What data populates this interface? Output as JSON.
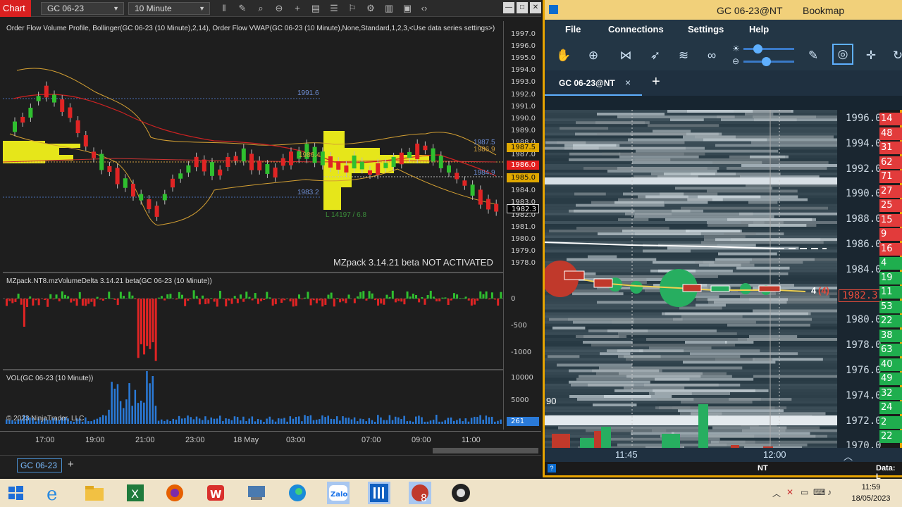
{
  "nt": {
    "chart_label": "Chart",
    "instrument": "GC 06-23",
    "interval": "10 Minute",
    "indicator_title": "Order Flow Volume Profile, Bollinger(GC 06-23 (10 Minute),2,14), Order Flow VWAP(GC 06-23 (10 Minute),None,Standard,1,2,3,<Use data series settings>)",
    "watermark": "MZpack 3.14.21 beta NOT ACTIVATED",
    "delta_title": "MZpack.NT8.mzVolumeDelta 3.14.21 beta(GC 06-23 (10 Minute))",
    "vol_title": "VOL(GC 06-23 (10 Minute))",
    "copyright": "© 2023 NinjaTrader, LLC",
    "price_labels": [
      "1997.0",
      "1996.0",
      "1995.0",
      "1994.0",
      "1993.0",
      "1992.0",
      "1991.0",
      "1990.0",
      "1989.0",
      "1988.0",
      "1987.0",
      "1986.0",
      "1985.0",
      "1984.0",
      "1983.0",
      "1982.0",
      "1981.0",
      "1980.0",
      "1979.0",
      "1978.0"
    ],
    "line_labels": {
      "l1991": "1991.6",
      "l1983": "1983.2",
      "l1987": "1987.5",
      "l1986_9": "1986.9",
      "l1986_4": "1986.4",
      "l1984_9": "1984.9",
      "poc": "L 14197 / 6.8"
    },
    "price_tags": {
      "t1987_5": "1987.5",
      "t1986": "1986.0",
      "t1985": "1985.0",
      "t1982_3": "1982.3"
    },
    "delta_axis": [
      "0",
      "-500",
      "-1000"
    ],
    "vol_axis": [
      "10000",
      "5000"
    ],
    "vol_tag": "261",
    "time_labels": [
      "17:00",
      "19:00",
      "21:00",
      "23:00",
      "18 May",
      "03:00",
      "07:00",
      "09:00",
      "11:00"
    ],
    "bottom_tab": "GC 06-23",
    "bottom_plus": "+"
  },
  "bm": {
    "title": "GC 06-23@NT",
    "app_name": "Bookmap",
    "menu": [
      "File",
      "Connections",
      "Settings",
      "Help"
    ],
    "tab": "GC 06-23@NT",
    "tab_close": "×",
    "tab_plus": "+",
    "prices": [
      "1996.0",
      "1994.0",
      "1992.0",
      "1990.0",
      "1988.0",
      "1986.0",
      "1984.0",
      "1982.3",
      "1980.0",
      "1978.0",
      "1976.0",
      "1974.0",
      "1972.0",
      "1970.0"
    ],
    "vol_cells": [
      "14",
      "48",
      "31",
      "62",
      "71",
      "27",
      "25",
      "15",
      "9",
      "16",
      "4",
      "19",
      "11",
      "53",
      "22",
      "38",
      "63",
      "40",
      "49",
      "32",
      "24",
      "2",
      "22"
    ],
    "current_marker": "4",
    "current_marker2": "(4)",
    "left_vol_label": "90",
    "time_labels": [
      "11:45",
      "12:00"
    ],
    "status_source": "NT",
    "status_data": "Data: L"
  },
  "taskbar": {
    "time": "11:59",
    "date": "18/05/2023"
  }
}
